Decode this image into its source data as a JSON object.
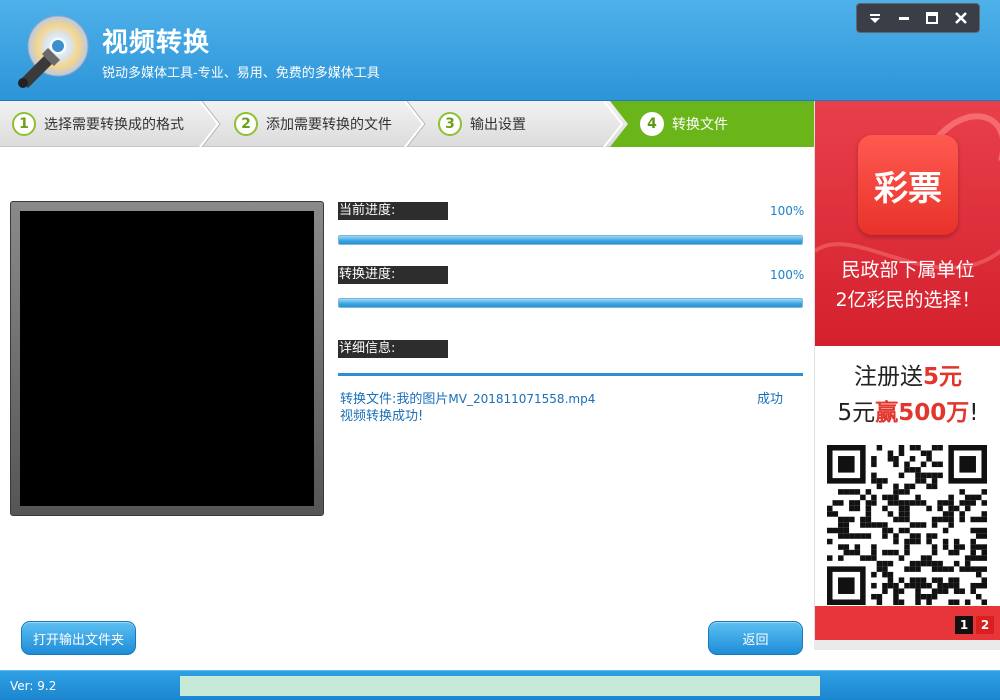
{
  "header": {
    "title": "视频转换",
    "subtitle": "锐动多媒体工具-专业、易用、免费的多媒体工具"
  },
  "window_controls": [
    "dropdown-icon",
    "minimize-icon",
    "maximize-icon",
    "close-icon"
  ],
  "steps": [
    {
      "num": "1",
      "label": "选择需要转换成的格式"
    },
    {
      "num": "2",
      "label": "添加需要转换的文件"
    },
    {
      "num": "3",
      "label": "输出设置"
    },
    {
      "num": "4",
      "label": "转换文件",
      "active": true
    }
  ],
  "progress": {
    "current_label": "当前进度:",
    "current_pct": "100%",
    "current_value": 1.0,
    "convert_label": "转换进度:",
    "convert_pct": "100%",
    "convert_value": 1.0,
    "detail_label": "详细信息:"
  },
  "detail": {
    "line1_prefix": "转换文件:我的图片",
    "line1_file": "MV_201811071558.mp4",
    "line2": "视频转换成功!",
    "status": "成功"
  },
  "buttons": {
    "open_folder": "打开输出文件夹",
    "back": "返回"
  },
  "footer": {
    "version": "Ver: 9.2"
  },
  "ad": {
    "logo_text": "彩票",
    "line1": "民政部下属单位",
    "line2": "2亿彩民的选择！",
    "line3_a": "注册送",
    "line3_b": "5元",
    "line4_a": "5元",
    "line4_b": "赢",
    "line4_c": "500万",
    "line4_d": "!",
    "pages": [
      "1",
      "2"
    ]
  },
  "colors": {
    "header": "#2c94d8",
    "step_active": "#6ab519",
    "progress": "#3aa4e1",
    "ad_red": "#d4202d"
  }
}
